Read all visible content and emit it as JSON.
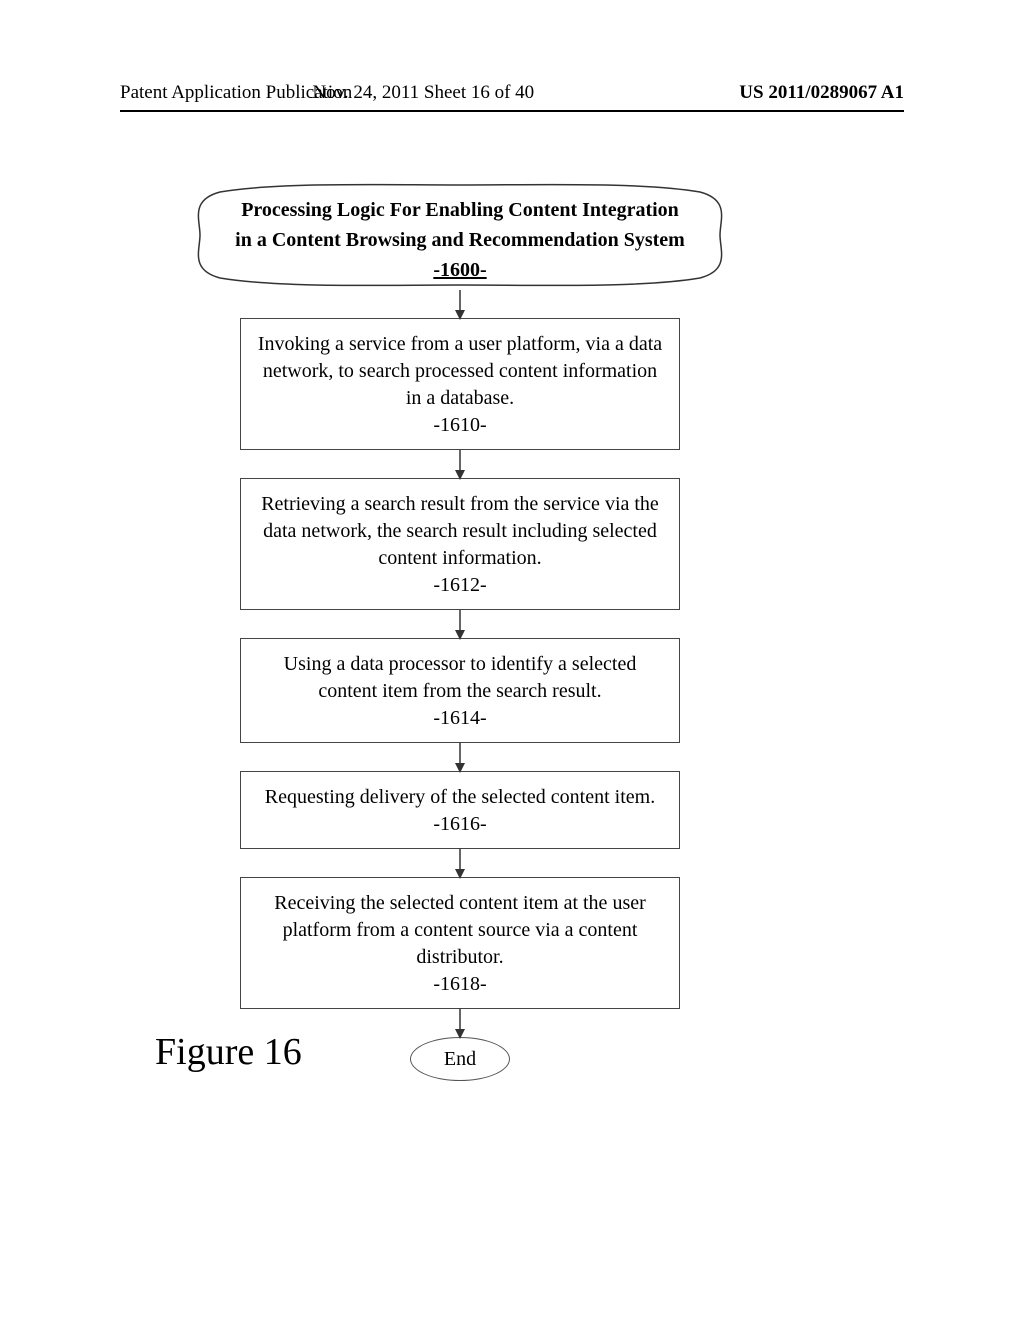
{
  "header": {
    "left": "Patent Application Publication",
    "center": "Nov. 24, 2011  Sheet 16 of 40",
    "right": "US 2011/0289067 A1"
  },
  "figure_label": "Figure 16",
  "chart_data": {
    "type": "flowchart",
    "title": {
      "line1": "Processing Logic For Enabling Content Integration",
      "line2": "in a Content Browsing and Recommendation System",
      "number": "-1600-"
    },
    "steps": [
      {
        "text": "Invoking a service from a user platform, via a data network, to search processed content information in a database.",
        "number": "-1610-"
      },
      {
        "text": "Retrieving a search result from the service via the data network, the search result including selected content information.",
        "number": "-1612-"
      },
      {
        "text": "Using a data processor to identify a selected content item from the search result.",
        "number": "-1614-"
      },
      {
        "text": "Requesting delivery of the selected content item.",
        "number": "-1616-"
      },
      {
        "text": "Receiving the selected content item at the user platform from a content source via a content distributor.",
        "number": "-1618-"
      }
    ],
    "end": "End"
  }
}
